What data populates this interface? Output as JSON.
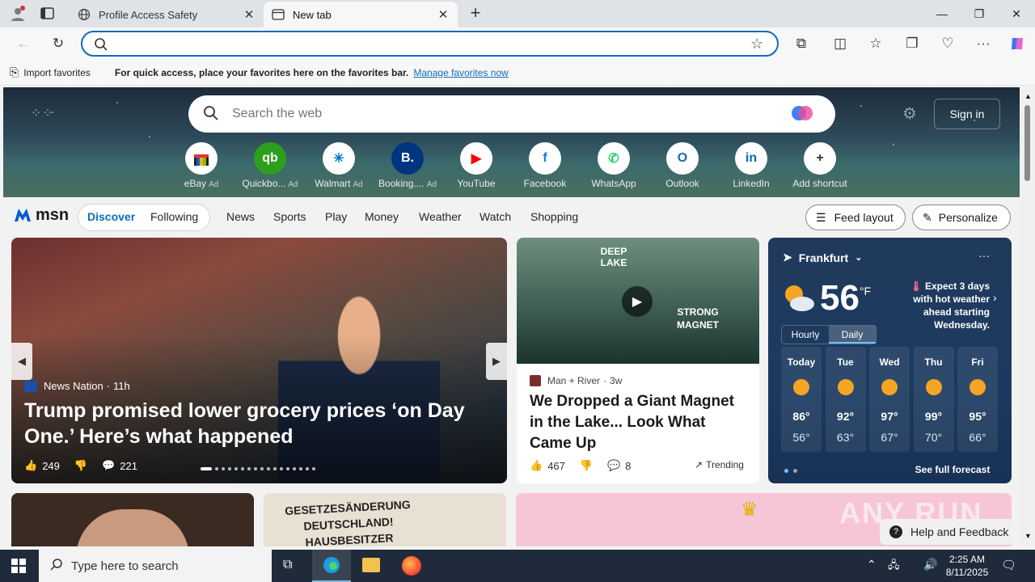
{
  "browser": {
    "tabs": [
      {
        "title": "Profile Access Safety",
        "active": false
      },
      {
        "title": "New tab",
        "active": true
      }
    ],
    "new_tab_symbol": "+",
    "address_value": "",
    "favorites_bar": {
      "import_label": "Import favorites",
      "message": "For quick access, place your favorites here on the favorites bar.",
      "manage_link": "Manage favorites now"
    }
  },
  "newtab": {
    "search_placeholder": "Search the web",
    "sign_in": "Sign in",
    "quick_links": [
      {
        "label": "eBay",
        "ad": "Ad",
        "glyph": "",
        "color": "#ffffff"
      },
      {
        "label": "Quickbo...",
        "ad": "Ad",
        "glyph": "qb",
        "color": "#2ca01c"
      },
      {
        "label": "Walmart",
        "ad": "Ad",
        "glyph": "✳",
        "color": "#0071ce"
      },
      {
        "label": "Booking....",
        "ad": "Ad",
        "glyph": "B.",
        "color": "#003580"
      },
      {
        "label": "YouTube",
        "ad": "",
        "glyph": "▶",
        "color": "#ff0000"
      },
      {
        "label": "Facebook",
        "ad": "",
        "glyph": "f",
        "color": "#1877f2"
      },
      {
        "label": "WhatsApp",
        "ad": "",
        "glyph": "✆",
        "color": "#25d366"
      },
      {
        "label": "Outlook",
        "ad": "",
        "glyph": "O",
        "color": "#0f6cbd"
      },
      {
        "label": "LinkedIn",
        "ad": "",
        "glyph": "in",
        "color": "#0a66c2"
      },
      {
        "label": "Add shortcut",
        "ad": "",
        "glyph": "+",
        "color": "#333333"
      }
    ]
  },
  "msn": {
    "logo": "msn",
    "tabs": [
      "Discover",
      "Following"
    ],
    "nav": [
      "News",
      "Sports",
      "Play",
      "Money",
      "Weather",
      "Watch",
      "Shopping"
    ],
    "feed_layout": "Feed layout",
    "personalize": "Personalize"
  },
  "lead_story": {
    "source": "News Nation",
    "age": "11h",
    "headline": "Trump promised lower grocery prices ‘on Day One.’ Here’s what happened",
    "likes": "249",
    "comments": "221"
  },
  "story2": {
    "image_text_1": "DEEP LAKE",
    "image_text_2": "STRONG MAGNET",
    "source": "Man + River",
    "age": "3w",
    "headline": "We Dropped a Giant Magnet in the Lake... Look What Came Up",
    "likes": "467",
    "comments": "8",
    "trending": "Trending"
  },
  "weather": {
    "city": "Frankfurt",
    "temp": "56",
    "unit": "°F",
    "alert": "Expect 3 days with hot weather ahead starting Wednesday.",
    "toggle": [
      "Hourly",
      "Daily"
    ],
    "days": [
      {
        "name": "Today",
        "high": "86°",
        "low": "56°"
      },
      {
        "name": "Tue",
        "high": "92°",
        "low": "63°"
      },
      {
        "name": "Wed",
        "high": "97°",
        "low": "67°"
      },
      {
        "name": "Thu",
        "high": "99°",
        "low": "70°"
      },
      {
        "name": "Fri",
        "high": "95°",
        "low": "66°"
      }
    ],
    "see_full": "See full forecast"
  },
  "story_b2_image_text": "GESETZESÄNDERUNG DEUTSCHLAND! HAUSBESITZER",
  "help_feedback": "Help and Feedback",
  "watermark": "ANY RUN",
  "taskbar": {
    "search_placeholder": "Type here to search",
    "time": "2:25 AM",
    "date": "8/11/2025"
  }
}
